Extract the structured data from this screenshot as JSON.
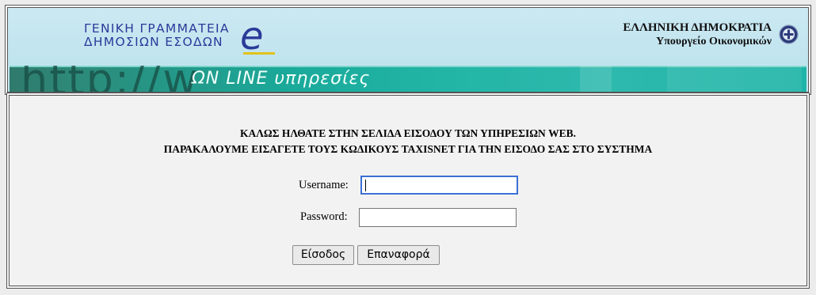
{
  "header": {
    "org_line1": "ΓΕΝΙΚΗ ΓΡΑΜΜΑΤΕΙΑ",
    "org_line2": "ΔΗΜΟΣΙΩΝ ΕΣΟΔΩΝ",
    "logo_letter": "e",
    "republic": "ΕΛΛΗΝΙΚΗ ΔΗΜΟΚΡΑΤΙΑ",
    "ministry": "Υπουργείο Οικονομικών"
  },
  "banner": {
    "http_text": "http://w",
    "online_text": "ΩΝ LINE υπηρεσίες"
  },
  "login": {
    "welcome_line1": "ΚΑΛΩΣ ΗΛΘΑΤΕ ΣΤΗΝ ΣΕΛΙΔΑ ΕΙΣΟΔΟΥ ΤΩΝ ΥΠΗΡΕΣΙΩΝ WEB.",
    "welcome_line2": "ΠΑΡΑΚΑΛΟΥΜΕ ΕΙΣΑΓΕΤΕ ΤΟΥΣ ΚΩΔΙΚΟΥΣ TAXISNET ΓΙΑ ΤΗΝ ΕΙΣΟΔΟ ΣΑΣ ΣΤΟ ΣΥΣΤΗΜΑ",
    "username_label": "Username:",
    "username_value": "",
    "password_label": "Password:",
    "password_value": "",
    "submit_label": "Είσοδος",
    "reset_label": "Επαναφορά"
  },
  "colors": {
    "header_bg": "#c5e6f0",
    "brand_blue": "#2a3a9a",
    "banner_teal": "#1aa99a",
    "focus_blue": "#3b6fd6"
  }
}
